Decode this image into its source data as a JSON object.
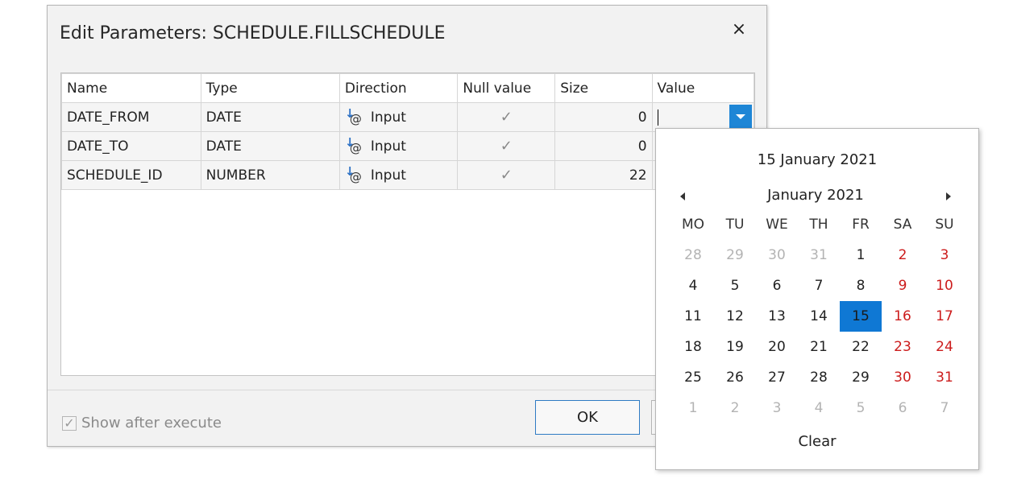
{
  "dialog": {
    "title": "Edit Parameters: SCHEDULE.FILLSCHEDULE",
    "close_glyph": "×",
    "show_after_execute_label": "Show after execute",
    "show_after_execute_checked": true,
    "ok_label": "OK"
  },
  "grid": {
    "columns": [
      "Name",
      "Type",
      "Direction",
      "Null value",
      "Size",
      "Value"
    ],
    "rows": [
      {
        "name": "DATE_FROM",
        "type": "DATE",
        "direction": "Input",
        "null_value": true,
        "size": "0",
        "value": ""
      },
      {
        "name": "DATE_TO",
        "type": "DATE",
        "direction": "Input",
        "null_value": true,
        "size": "0",
        "value": ""
      },
      {
        "name": "SCHEDULE_ID",
        "type": "NUMBER",
        "direction": "Input",
        "null_value": true,
        "size": "22",
        "value": ""
      }
    ],
    "direction_icon": "input-direction-icon",
    "check_glyph": "✓"
  },
  "calendar": {
    "today_label": "15 January 2021",
    "month_label": "January 2021",
    "weekdays": [
      "MO",
      "TU",
      "WE",
      "TH",
      "FR",
      "SA",
      "SU"
    ],
    "weeks": [
      [
        "28",
        "29",
        "30",
        "31",
        "1",
        "2",
        "3"
      ],
      [
        "4",
        "5",
        "6",
        "7",
        "8",
        "9",
        "10"
      ],
      [
        "11",
        "12",
        "13",
        "14",
        "15",
        "16",
        "17"
      ],
      [
        "18",
        "19",
        "20",
        "21",
        "22",
        "23",
        "24"
      ],
      [
        "25",
        "26",
        "27",
        "28",
        "29",
        "30",
        "31"
      ],
      [
        "1",
        "2",
        "3",
        "4",
        "5",
        "6",
        "7"
      ]
    ],
    "other_month_mask": [
      [
        true,
        true,
        true,
        true,
        false,
        false,
        false
      ],
      [
        false,
        false,
        false,
        false,
        false,
        false,
        false
      ],
      [
        false,
        false,
        false,
        false,
        false,
        false,
        false
      ],
      [
        false,
        false,
        false,
        false,
        false,
        false,
        false
      ],
      [
        false,
        false,
        false,
        false,
        false,
        false,
        false
      ],
      [
        true,
        true,
        true,
        true,
        true,
        true,
        true
      ]
    ],
    "selected_day": "15",
    "clear_label": "Clear"
  },
  "colors": {
    "accent": "#0f78d4",
    "weekend": "#cc1c1c",
    "other_month": "#b3b3b3"
  }
}
